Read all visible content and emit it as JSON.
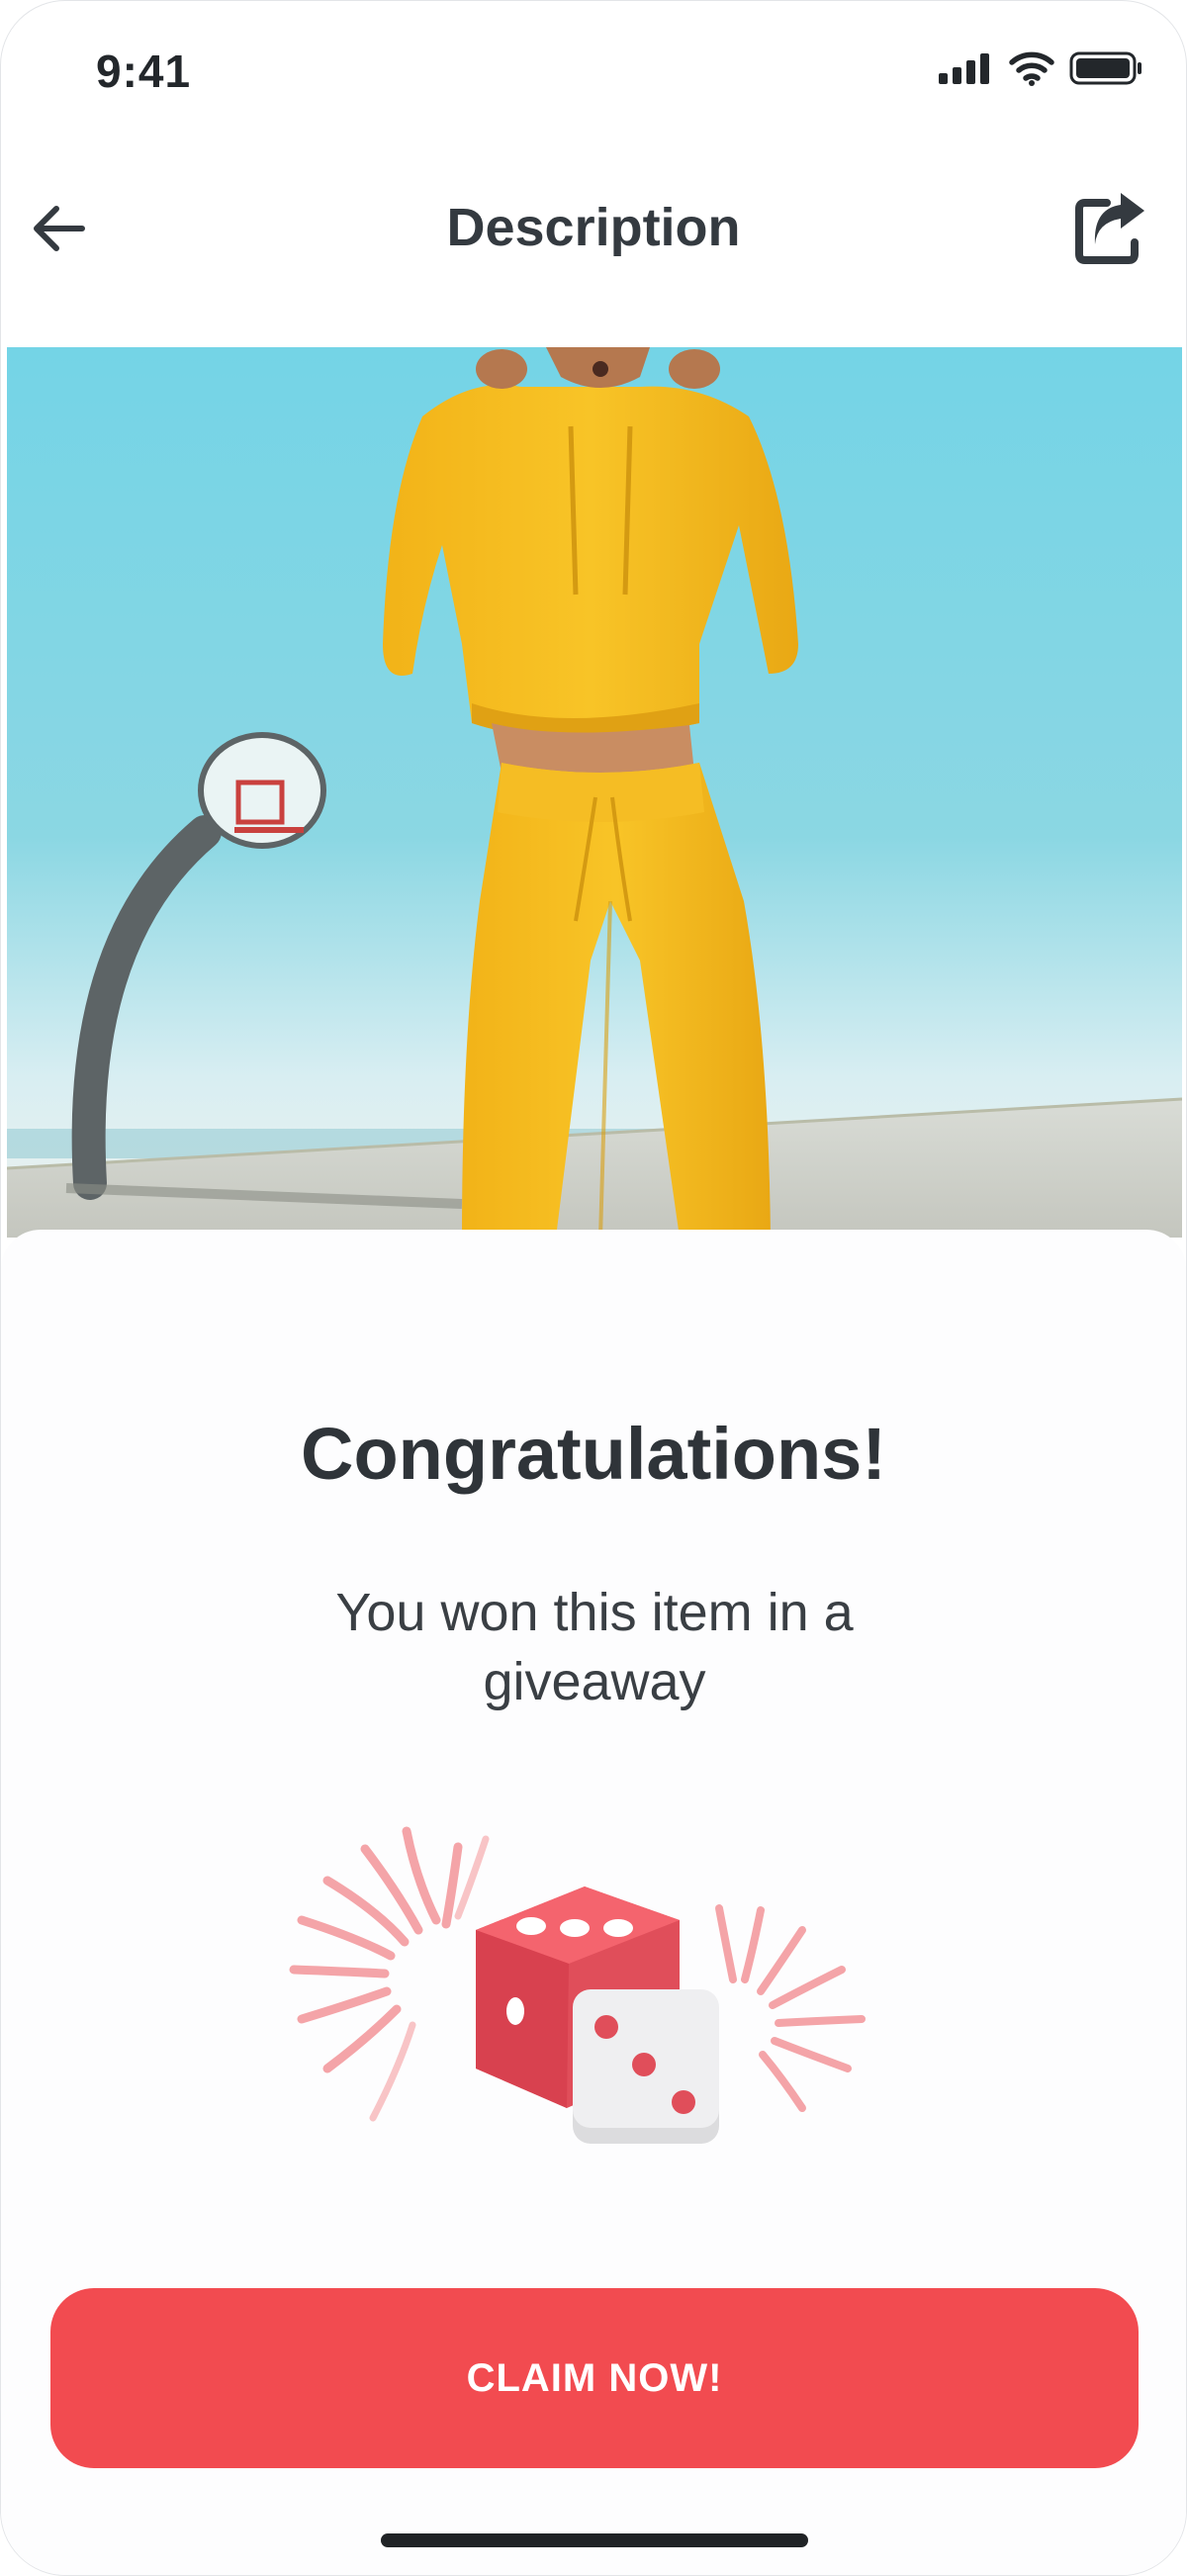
{
  "status_bar": {
    "time": "9:41",
    "icons": [
      "signal-icon",
      "wifi-icon",
      "battery-icon"
    ]
  },
  "header": {
    "title": "Description",
    "back_icon": "arrow-left-icon",
    "share_icon": "share-icon"
  },
  "hero": {
    "subject": "product-photo"
  },
  "card": {
    "title": "Congratulations!",
    "message": "You won this item in a giveaway",
    "illustration": "dice-fireworks-icon"
  },
  "cta": {
    "label": "CLAIM NOW!"
  },
  "colors": {
    "accent": "#f24b50",
    "text_dark": "#343a40",
    "dice_red": "#f4626b",
    "dice_grey": "#ececef"
  }
}
